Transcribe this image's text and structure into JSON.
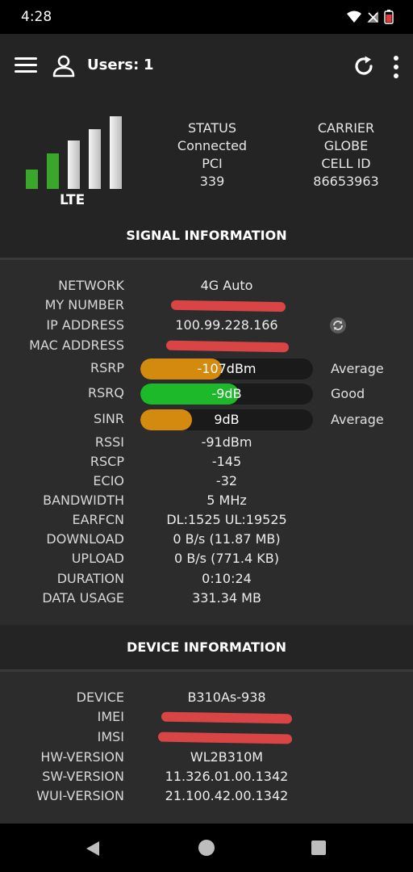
{
  "status_bar": {
    "time": "4:28"
  },
  "app_bar": {
    "users_label": "Users:",
    "users_count": "1"
  },
  "signal_bars": {
    "technology": "LTE",
    "active": 2,
    "total": 5
  },
  "status": {
    "status_label": "STATUS",
    "status_value": "Connected",
    "pci_label": "PCI",
    "pci_value": "339",
    "carrier_label": "CARRIER",
    "carrier_value": "GLOBE",
    "cell_id_label": "CELL ID",
    "cell_id_value": "86653963"
  },
  "signal_section_title": "SIGNAL INFORMATION",
  "signal": {
    "network": {
      "label": "NETWORK",
      "value": "4G Auto"
    },
    "my_number": {
      "label": "MY NUMBER"
    },
    "ip_address": {
      "label": "IP ADDRESS",
      "value": "100.99.228.166"
    },
    "mac_address": {
      "label": "MAC ADDRESS"
    },
    "rsrp": {
      "label": "RSRP",
      "value": "-107dBm",
      "quality": "Average",
      "level": 0.47,
      "color": "#d48a0e"
    },
    "rsrq": {
      "label": "RSRQ",
      "value": "-9dB",
      "quality": "Good",
      "level": 0.57,
      "color": "#1db92a"
    },
    "sinr": {
      "label": "SINR",
      "value": "9dB",
      "quality": "Average",
      "level": 0.3,
      "color": "#d48a0e"
    },
    "rssi": {
      "label": "RSSI",
      "value": "-91dBm"
    },
    "rscp": {
      "label": "RSCP",
      "value": "-145"
    },
    "ecio": {
      "label": "ECIO",
      "value": "-32"
    },
    "bandwidth": {
      "label": "BANDWIDTH",
      "value": "5 MHz"
    },
    "earfcn": {
      "label": "EARFCN",
      "value": "DL:1525 UL:19525"
    },
    "download": {
      "label": "DOWNLOAD",
      "value": "0 B/s (11.87 MB)"
    },
    "upload": {
      "label": "UPLOAD",
      "value": "0 B/s (771.4 KB)"
    },
    "duration": {
      "label": "DURATION",
      "value": "0:10:24"
    },
    "data_usage": {
      "label": "DATA USAGE",
      "value": "331.34 MB"
    }
  },
  "device_section_title": "DEVICE INFORMATION",
  "device": {
    "device": {
      "label": "DEVICE",
      "value": "B310As-938"
    },
    "imei": {
      "label": "IMEI"
    },
    "imsi": {
      "label": "IMSI"
    },
    "hw_version": {
      "label": "HW-VERSION",
      "value": "WL2B310M"
    },
    "sw_version": {
      "label": "SW-VERSION",
      "value": "11.326.01.00.1342"
    },
    "wui_version": {
      "label": "WUI-VERSION",
      "value": "21.100.42.00.1342"
    }
  },
  "colors": {
    "active_bar": "#3aa62c",
    "inactive_bar": "#e8e8e8",
    "redaction": "#e84848"
  }
}
